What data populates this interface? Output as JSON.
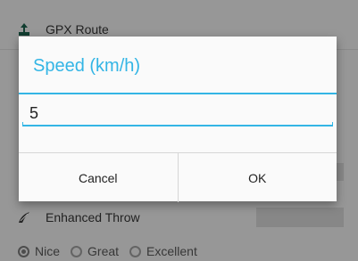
{
  "background": {
    "gpx_route_label": "GPX Route",
    "enhanced_throw_label": "Enhanced Throw",
    "throw_options": [
      {
        "label": "Nice",
        "selected": true
      },
      {
        "label": "Great",
        "selected": false
      },
      {
        "label": "Excellent",
        "selected": false
      }
    ]
  },
  "dialog": {
    "title": "Speed (km/h)",
    "input_value": "5",
    "cancel_label": "Cancel",
    "ok_label": "OK"
  },
  "colors": {
    "accent": "#33b5e5",
    "scrim": "rgba(0,0,0,0.35)"
  },
  "icons": [
    "route-icon",
    "throw-icon"
  ]
}
